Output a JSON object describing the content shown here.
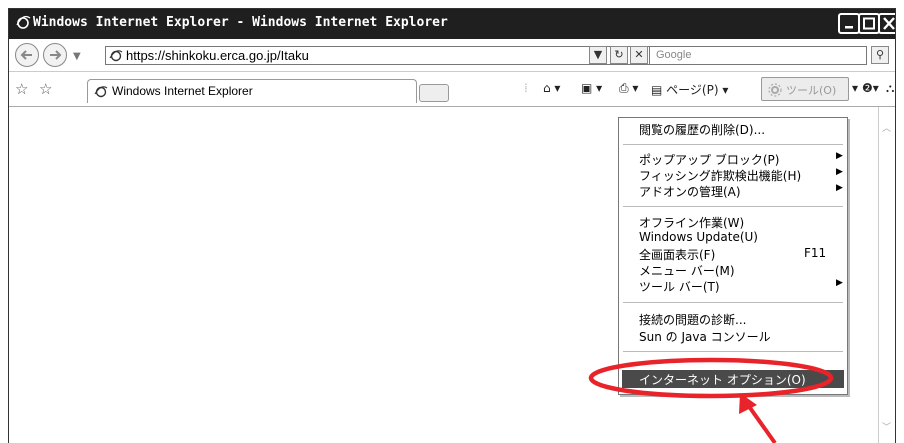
{
  "window": {
    "title": "Windows Internet Explorer - Windows Internet Explorer"
  },
  "address_bar": {
    "url": "https://shinkoku.erca.go.jp/Itaku",
    "search_placeholder": "Google"
  },
  "tab": {
    "title": "Windows Internet Explorer"
  },
  "command_bar": {
    "page_label": "ページ(P)",
    "tools_label": "ツール(O)"
  },
  "tools_menu": {
    "items": [
      {
        "label": "閲覧の履歴の削除(D)..."
      },
      {
        "label": "ポップアップ ブロック(P)"
      },
      {
        "label": "フィッシング詐欺検出機能(H)"
      },
      {
        "label": "アドオンの管理(A)"
      },
      {
        "label": "オフライン作業(W)"
      },
      {
        "label": "Windows Update(U)"
      },
      {
        "label": "全画面表示(F)",
        "shortcut": "F11"
      },
      {
        "label": "メニュー バー(M)"
      },
      {
        "label": "ツール バー(T)"
      },
      {
        "label": "接続の問題の診断..."
      },
      {
        "label": "Sun の Java コンソール"
      },
      {
        "label": "インターネット オプション(O)"
      }
    ],
    "selected_item": "インターネット オプション(O)"
  },
  "annotation": {
    "highlight_color": "#e8232a"
  }
}
